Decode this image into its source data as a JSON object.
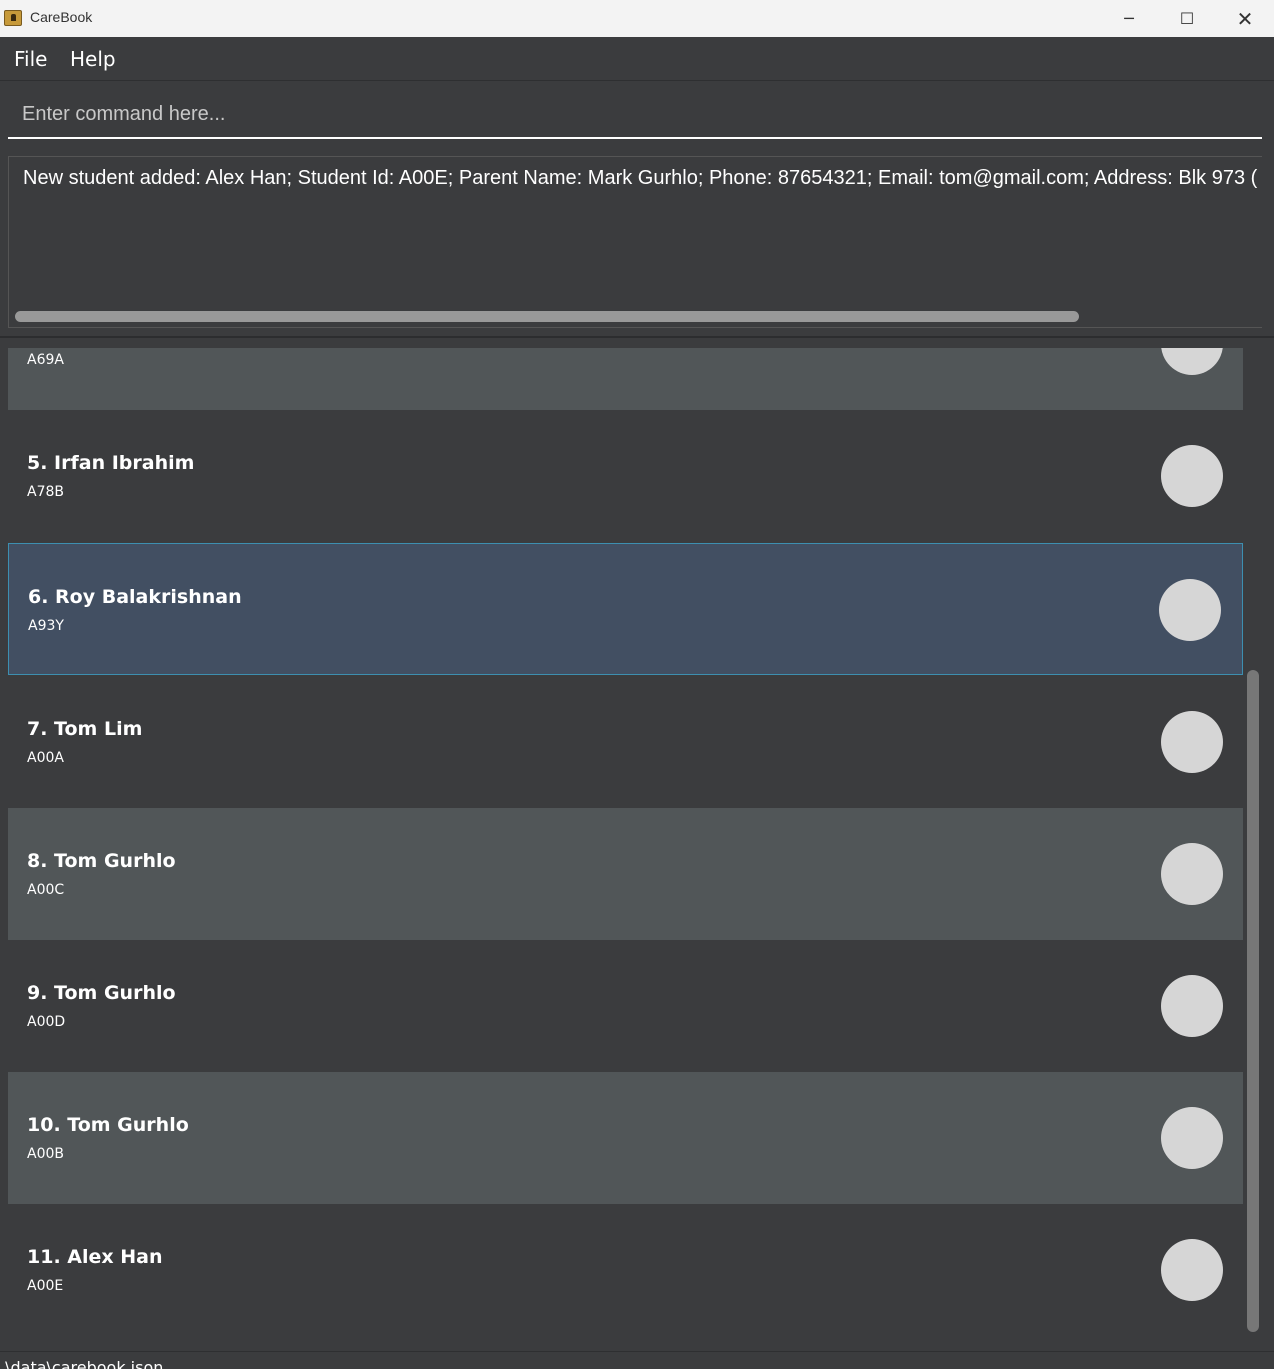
{
  "window": {
    "title": "CareBook",
    "minimize": "─",
    "maximize": "☐",
    "close": "✕"
  },
  "menu": {
    "file": "File",
    "help": "Help"
  },
  "command": {
    "placeholder": "Enter command here...",
    "value": ""
  },
  "result": {
    "text": "New student added: Alex Han; Student Id: A00E; Parent Name: Mark Gurhlo; Phone: 87654321; Email: tom@gmail.com; Address: Blk 973 ("
  },
  "students": [
    {
      "name": "",
      "id": "A69A"
    },
    {
      "name": "5. Irfan Ibrahim",
      "id": "A78B"
    },
    {
      "name": "6. Roy Balakrishnan",
      "id": "A93Y"
    },
    {
      "name": "7. Tom Lim",
      "id": "A00A"
    },
    {
      "name": "8. Tom Gurhlo",
      "id": "A00C"
    },
    {
      "name": "9. Tom Gurhlo",
      "id": "A00D"
    },
    {
      "name": "10. Tom Gurhlo",
      "id": "A00B"
    },
    {
      "name": "11. Alex Han",
      "id": "A00E"
    }
  ],
  "status": {
    "path": ".\\data\\carebook.json"
  },
  "colors": {
    "background": "#3b3c3e",
    "card_alt": "#515658",
    "selected": "#424f62",
    "selected_border": "#3d8fb0",
    "avatar": "#d6d6d6"
  }
}
